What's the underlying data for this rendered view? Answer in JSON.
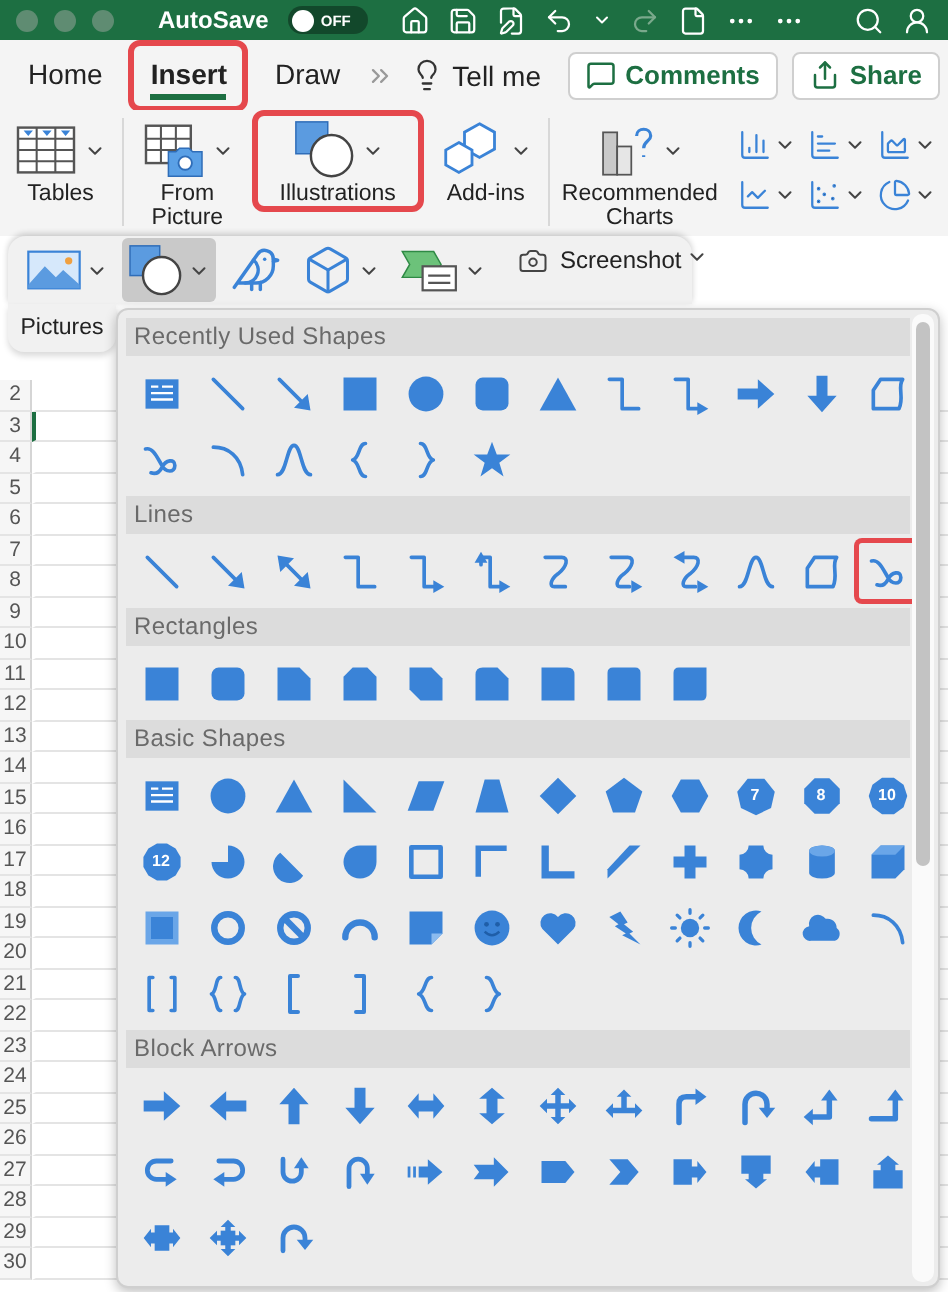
{
  "title_bar": {
    "autosave": {
      "label": "AutoSave",
      "toggle_text": "OFF",
      "on": false
    }
  },
  "tabs": [
    {
      "label": "Home",
      "selected": false,
      "highlighted": false
    },
    {
      "label": "Insert",
      "selected": true,
      "highlighted": true
    },
    {
      "label": "Draw",
      "selected": false,
      "highlighted": false
    }
  ],
  "tell_me": "Tell me",
  "header_buttons": [
    {
      "kind": "comments",
      "label": "Comments"
    },
    {
      "kind": "share",
      "label": "Share"
    }
  ],
  "ribbon": [
    {
      "kind": "tables",
      "label": "Tables",
      "highlighted": false
    },
    {
      "kind": "from-picture",
      "label": "From Picture",
      "highlighted": false
    },
    {
      "kind": "illustrations",
      "label": "Illustrations",
      "highlighted": true
    },
    {
      "kind": "add-ins",
      "label": "Add-ins",
      "highlighted": false
    },
    {
      "kind": "charts",
      "label": "Recommended Charts",
      "highlighted": false
    }
  ],
  "illustrations_menu": {
    "pictures_label": "Pictures",
    "items": [
      {
        "kind": "pictures",
        "selected": false
      },
      {
        "kind": "shapes",
        "selected": true
      },
      {
        "kind": "icons",
        "selected": false
      },
      {
        "kind": "models",
        "selected": false
      },
      {
        "kind": "smartart",
        "selected": false
      },
      {
        "kind": "screenshot",
        "label": "Screenshot",
        "selected": false
      }
    ]
  },
  "shapes_panel": {
    "sections": [
      {
        "title": "Recently Used Shapes",
        "shapes": [
          {
            "kind": "textbox",
            "highlighted": false
          },
          {
            "kind": "line",
            "highlighted": false
          },
          {
            "kind": "arrow-line",
            "highlighted": false
          },
          {
            "kind": "square",
            "highlighted": false
          },
          {
            "kind": "circle",
            "highlighted": false
          },
          {
            "kind": "rounded-square",
            "highlighted": false
          },
          {
            "kind": "triangle",
            "highlighted": false
          },
          {
            "kind": "elbow",
            "highlighted": false
          },
          {
            "kind": "elbow-arrow",
            "highlighted": false
          },
          {
            "kind": "right-arrow",
            "highlighted": false
          },
          {
            "kind": "down-arrow",
            "highlighted": false
          },
          {
            "kind": "freeform",
            "highlighted": false
          },
          {
            "kind": "scribble",
            "highlighted": false
          },
          {
            "kind": "arc",
            "highlighted": false
          },
          {
            "kind": "curve",
            "highlighted": false
          },
          {
            "kind": "left-brace",
            "highlighted": false
          },
          {
            "kind": "right-brace",
            "highlighted": false
          },
          {
            "kind": "star",
            "highlighted": false
          }
        ]
      },
      {
        "title": "Lines",
        "shapes": [
          {
            "kind": "line",
            "highlighted": false
          },
          {
            "kind": "arrow-line",
            "highlighted": false
          },
          {
            "kind": "double-arrow-line",
            "highlighted": false
          },
          {
            "kind": "elbow",
            "highlighted": false
          },
          {
            "kind": "elbow-arrow",
            "highlighted": false
          },
          {
            "kind": "elbow-double-arrow",
            "highlighted": false
          },
          {
            "kind": "curved-connector",
            "highlighted": false
          },
          {
            "kind": "curved-arrow-connector",
            "highlighted": false
          },
          {
            "kind": "curved-double-arrow-connector",
            "highlighted": false
          },
          {
            "kind": "curve",
            "highlighted": false
          },
          {
            "kind": "freeform",
            "highlighted": false
          },
          {
            "kind": "scribble",
            "highlighted": true
          }
        ]
      },
      {
        "title": "Rectangles",
        "shapes": [
          {
            "kind": "rectangle",
            "highlighted": false
          },
          {
            "kind": "rounded-rectangle",
            "highlighted": false
          },
          {
            "kind": "snip-corner-rectangle",
            "highlighted": false
          },
          {
            "kind": "snip-same-side-rectangle",
            "highlighted": false
          },
          {
            "kind": "snip-diagonal-rectangle",
            "highlighted": false
          },
          {
            "kind": "snip-round-rectangle",
            "highlighted": false
          },
          {
            "kind": "round-corner-rectangle",
            "highlighted": false
          },
          {
            "kind": "round-same-side-rectangle",
            "highlighted": false
          },
          {
            "kind": "round-diagonal-rectangle",
            "highlighted": false
          }
        ]
      },
      {
        "title": "Basic Shapes",
        "shapes": [
          {
            "kind": "textbox",
            "highlighted": false
          },
          {
            "kind": "circle",
            "highlighted": false
          },
          {
            "kind": "triangle",
            "highlighted": false
          },
          {
            "kind": "right-triangle",
            "highlighted": false
          },
          {
            "kind": "parallelogram",
            "highlighted": false
          },
          {
            "kind": "trapezoid",
            "highlighted": false
          },
          {
            "kind": "diamond",
            "highlighted": false
          },
          {
            "kind": "pentagon",
            "highlighted": false
          },
          {
            "kind": "hexagon",
            "highlighted": false
          },
          {
            "kind": "heptagon",
            "label": "7",
            "highlighted": false
          },
          {
            "kind": "octagon",
            "label": "8",
            "highlighted": false
          },
          {
            "kind": "decagon",
            "label": "10",
            "highlighted": false
          },
          {
            "kind": "dodecagon",
            "label": "12",
            "highlighted": false
          },
          {
            "kind": "pie",
            "highlighted": false
          },
          {
            "kind": "chord",
            "highlighted": false
          },
          {
            "kind": "teardrop",
            "highlighted": false
          },
          {
            "kind": "frame",
            "highlighted": false
          },
          {
            "kind": "half-frame",
            "highlighted": false
          },
          {
            "kind": "l-shape",
            "highlighted": false
          },
          {
            "kind": "diagonal-stripe",
            "highlighted": false
          },
          {
            "kind": "plus",
            "highlighted": false
          },
          {
            "kind": "plaque",
            "highlighted": false
          },
          {
            "kind": "cylinder",
            "highlighted": false
          },
          {
            "kind": "cube",
            "highlighted": false
          },
          {
            "kind": "bevel",
            "highlighted": false
          },
          {
            "kind": "donut",
            "highlighted": false
          },
          {
            "kind": "no-symbol",
            "highlighted": false
          },
          {
            "kind": "block-arc",
            "highlighted": false
          },
          {
            "kind": "folded-corner",
            "highlighted": false
          },
          {
            "kind": "smiley",
            "highlighted": false
          },
          {
            "kind": "heart",
            "highlighted": false
          },
          {
            "kind": "lightning",
            "highlighted": false
          },
          {
            "kind": "sun",
            "highlighted": false
          },
          {
            "kind": "moon",
            "highlighted": false
          },
          {
            "kind": "cloud",
            "highlighted": false
          },
          {
            "kind": "arc",
            "highlighted": false
          },
          {
            "kind": "double-bracket",
            "highlighted": false
          },
          {
            "kind": "double-brace",
            "highlighted": false
          },
          {
            "kind": "left-bracket",
            "highlighted": false
          },
          {
            "kind": "right-bracket",
            "highlighted": false
          },
          {
            "kind": "left-brace",
            "highlighted": false
          },
          {
            "kind": "right-brace",
            "highlighted": false
          }
        ]
      },
      {
        "title": "Block Arrows",
        "shapes": [
          {
            "kind": "right-arrow",
            "highlighted": false
          },
          {
            "kind": "left-arrow",
            "highlighted": false
          },
          {
            "kind": "up-arrow",
            "highlighted": false
          },
          {
            "kind": "down-arrow",
            "highlighted": false
          },
          {
            "kind": "left-right-arrow",
            "highlighted": false
          },
          {
            "kind": "up-down-arrow",
            "highlighted": false
          },
          {
            "kind": "quad-arrow",
            "highlighted": false
          },
          {
            "kind": "left-right-up-arrow",
            "highlighted": false
          },
          {
            "kind": "bent-arrow",
            "highlighted": false
          },
          {
            "kind": "u-turn-arrow",
            "highlighted": false
          },
          {
            "kind": "left-up-arrow",
            "highlighted": false
          },
          {
            "kind": "bent-up-arrow",
            "highlighted": false
          },
          {
            "kind": "curved-right-arrow",
            "highlighted": false
          },
          {
            "kind": "curved-left-arrow",
            "highlighted": false
          },
          {
            "kind": "curved-up-arrow",
            "highlighted": false
          },
          {
            "kind": "curved-down-arrow",
            "highlighted": false
          },
          {
            "kind": "striped-right-arrow",
            "highlighted": false
          },
          {
            "kind": "notched-right-arrow",
            "highlighted": false
          },
          {
            "kind": "pentagon-arrow",
            "highlighted": false
          },
          {
            "kind": "chevron",
            "highlighted": false
          },
          {
            "kind": "right-arrow-callout",
            "highlighted": false
          },
          {
            "kind": "down-arrow-callout",
            "highlighted": false
          },
          {
            "kind": "left-arrow-callout",
            "highlighted": false
          },
          {
            "kind": "up-arrow-callout",
            "highlighted": false
          },
          {
            "kind": "left-right-arrow-callout",
            "highlighted": false
          },
          {
            "kind": "quad-arrow-callout",
            "highlighted": false
          },
          {
            "kind": "circular-arrow",
            "highlighted": false
          }
        ]
      }
    ]
  },
  "sheet": {
    "rows": [
      {
        "number": "2",
        "selected": false
      },
      {
        "number": "3",
        "selected": true
      },
      {
        "number": "4",
        "selected": false
      },
      {
        "number": "5",
        "selected": false
      },
      {
        "number": "6",
        "selected": false
      },
      {
        "number": "7",
        "selected": false
      },
      {
        "number": "8",
        "selected": false
      },
      {
        "number": "9",
        "selected": false
      },
      {
        "number": "10",
        "selected": false
      },
      {
        "number": "11",
        "selected": false
      },
      {
        "number": "12",
        "selected": false
      },
      {
        "number": "13",
        "selected": false
      },
      {
        "number": "14",
        "selected": false
      },
      {
        "number": "15",
        "selected": false
      },
      {
        "number": "16",
        "selected": false
      },
      {
        "number": "17",
        "selected": false
      },
      {
        "number": "18",
        "selected": false
      },
      {
        "number": "19",
        "selected": false
      },
      {
        "number": "20",
        "selected": false
      },
      {
        "number": "21",
        "selected": false
      },
      {
        "number": "22",
        "selected": false
      },
      {
        "number": "23",
        "selected": false
      },
      {
        "number": "24",
        "selected": false
      },
      {
        "number": "25",
        "selected": false
      },
      {
        "number": "26",
        "selected": false
      },
      {
        "number": "27",
        "selected": false
      },
      {
        "number": "28",
        "selected": false
      },
      {
        "number": "29",
        "selected": false
      },
      {
        "number": "30",
        "selected": false
      }
    ]
  }
}
